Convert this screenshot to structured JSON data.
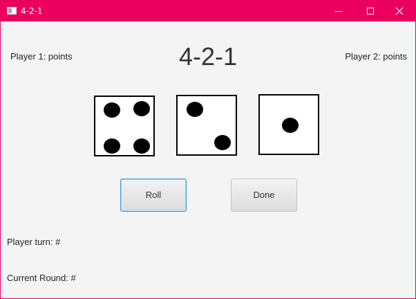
{
  "window": {
    "title": "4-2-1",
    "titlebar_color": "#ec005f"
  },
  "header": {
    "player1": "Player 1: points",
    "title": "4-2-1",
    "player2": "Player 2: points"
  },
  "dice": [
    {
      "value": 4
    },
    {
      "value": 2
    },
    {
      "value": 1
    }
  ],
  "buttons": {
    "roll": "Roll",
    "done": "Done"
  },
  "status": {
    "turn": "Player turn: #",
    "round": "Current Round: #"
  },
  "icons": {
    "app": "app-icon",
    "minimize": "minimize-icon",
    "maximize": "maximize-icon",
    "close": "close-icon"
  }
}
